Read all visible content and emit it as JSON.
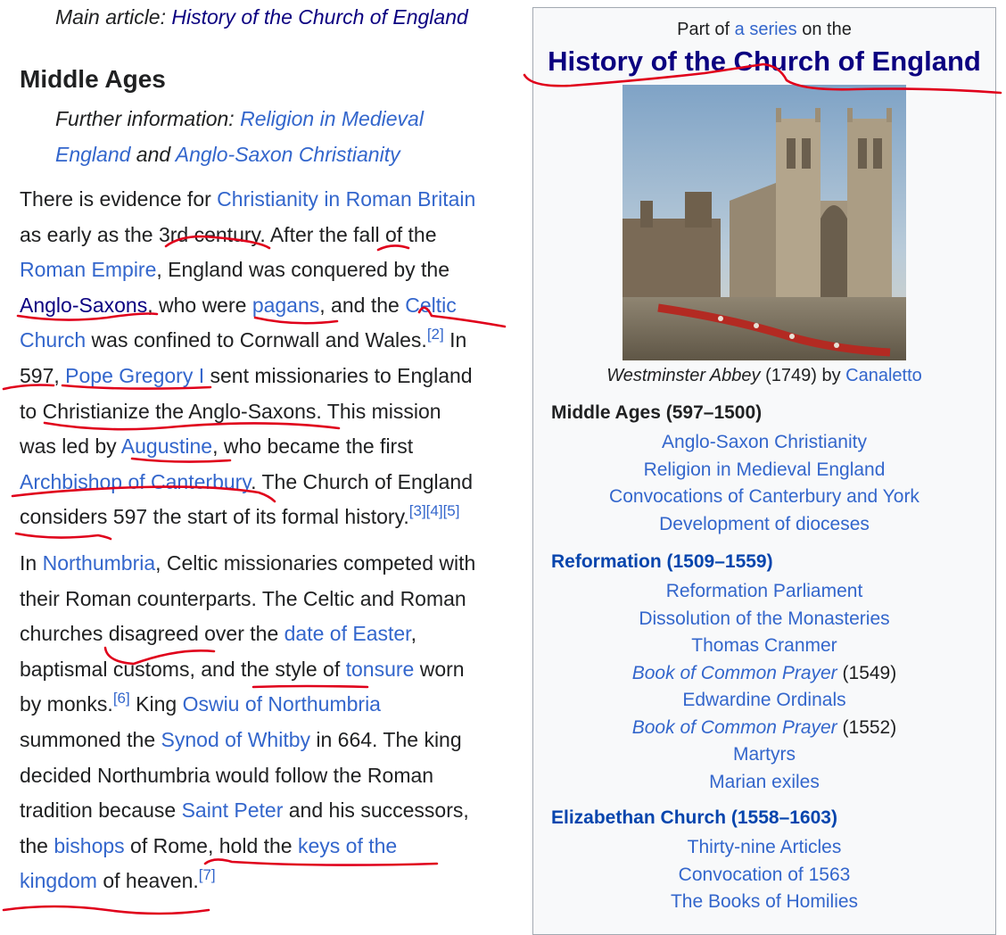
{
  "hatnote_main": {
    "prefix": "Main article: ",
    "link": "History of the Church of England"
  },
  "section": {
    "heading": "Middle Ages"
  },
  "hatnote_further": {
    "prefix": "Further information: ",
    "link1_a": "Religion in Medieval",
    "link1_b": "England",
    "and": " and ",
    "link2": "Anglo-Saxon Christianity"
  },
  "para1": {
    "l1_t1": "There is evidence for ",
    "l1_link": "Christianity in Roman Britain",
    "l2_t1": "as early as the ",
    "l2_link1": "3rd century",
    "l2_t2": ". After the ",
    "l2_link2": "fall",
    "l2_t3": " of the",
    "l3_link": "Roman Empire",
    "l3_t1": ", England was conquered by the",
    "l4_link1": "Anglo-Saxons",
    "l4_t1": ", who were ",
    "l4_link2": "pagans",
    "l4_t2": ", and the ",
    "l4_link3": "Celtic",
    "l5_link": "Church",
    "l5_t1": " was confined to Cornwall and Wales.",
    "l5_ref": "[2]",
    "l5_t2": " In",
    "l6_t1": "597, ",
    "l6_link": "Pope Gregory I",
    "l6_t2": " sent missionaries to England",
    "l7_t1": "to ",
    "l7_link": "Christianize",
    "l7_t2": " the Anglo-Saxons. This mission",
    "l8_t1": "was led by ",
    "l8_link": "Augustine",
    "l8_t2": ", who became the first",
    "l9_link": "Archbishop of Canterbury",
    "l9_t1": ". The Church of England",
    "l10_t1": "considers 597 the start of its formal history.",
    "l10_ref1": "[3]",
    "l10_ref2": "[4]",
    "l10_ref3": "[5]"
  },
  "para2": {
    "l1_t1": "In ",
    "l1_link": "Northumbria",
    "l1_t2": ", Celtic missionaries competed with",
    "l2_t1": "their Roman counterparts. The Celtic and Roman",
    "l3_t1": "churches disagreed over the ",
    "l3_link": "date of Easter",
    "l3_t2": ",",
    "l4_t1": "baptismal customs, and the style of ",
    "l4_link": "tonsure",
    "l4_t2": " worn",
    "l5_t1": "by monks.",
    "l5_ref": "[6]",
    "l5_t2": " King ",
    "l5_link": "Oswiu of Northumbria",
    "l6_t1": "summoned the ",
    "l6_link": "Synod of Whitby",
    "l6_t2": " in 664. The king",
    "l7_t1": "decided Northumbria would follow the Roman",
    "l8_t1": "tradition because ",
    "l8_link": "Saint Peter",
    "l8_t2": " and his successors,",
    "l9_t1": "the ",
    "l9_link1": "bishops",
    "l9_t2": " of Rome, hold the ",
    "l9_link2": "keys of the",
    "l10_link": "kingdom",
    "l10_t1": " of heaven.",
    "l10_ref": "[7]"
  },
  "infobox": {
    "series_prefix": "Part of ",
    "series_link": "a series",
    "series_suffix": " on the",
    "title": "History of the Church of England",
    "caption_italic": "Westminster Abbey",
    "caption_text": " (1749) by ",
    "caption_link": "Canaletto",
    "groups": [
      {
        "heading": "Middle Ages (597–1500)",
        "items": [
          "Anglo-Saxon Christianity",
          "Religion in Medieval England",
          "Convocations of Canterbury and York",
          "Development of dioceses"
        ]
      },
      {
        "heading": "Reformation (1509–1559)",
        "items": [
          "Reformation Parliament",
          "Dissolution of the Monasteries",
          "Thomas Cranmer",
          "Book of Common Prayer",
          "Edwardine Ordinals",
          "Book of Common Prayer",
          "Martyrs",
          "Marian exiles"
        ],
        "book1_year": " (1549)",
        "book2_year": " (1552)"
      },
      {
        "heading": "Elizabethan Church (1558–1603)",
        "items": [
          "Thirty-nine Articles",
          "Convocation of 1563",
          "The Books of Homilies"
        ]
      }
    ]
  },
  "colors": {
    "link": "#3366cc",
    "visited": "#0b0080",
    "annotation": "#e0001b",
    "infobox_bg": "#f8f9fa"
  }
}
